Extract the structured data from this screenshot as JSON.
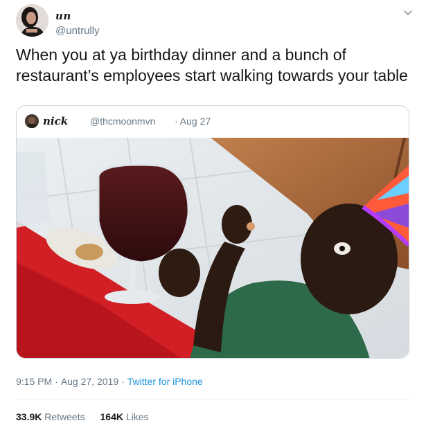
{
  "author": {
    "display_name": "un",
    "handle": "@untrully"
  },
  "tweet": {
    "text_line1": "When you at ya birthday dinner and a bunch of",
    "text_line2": "restaurant’s employees start walking towards your table"
  },
  "quoted_tweet": {
    "display_name": "nick",
    "handle": "@thcmoonmvn",
    "date": "Aug 27"
  },
  "meta": {
    "time": "9:15 PM",
    "date": "Aug 27, 2019",
    "source": "Twitter for iPhone"
  },
  "stats": {
    "retweets_count": "33.9K",
    "retweets_label": "Retweets",
    "likes_count": "164K",
    "likes_label": "Likes"
  },
  "icons": {
    "menu": "chevron-down-icon"
  },
  "colors": {
    "link": "#1b95e0",
    "muted": "#657786",
    "border": "#ccd6dd"
  }
}
